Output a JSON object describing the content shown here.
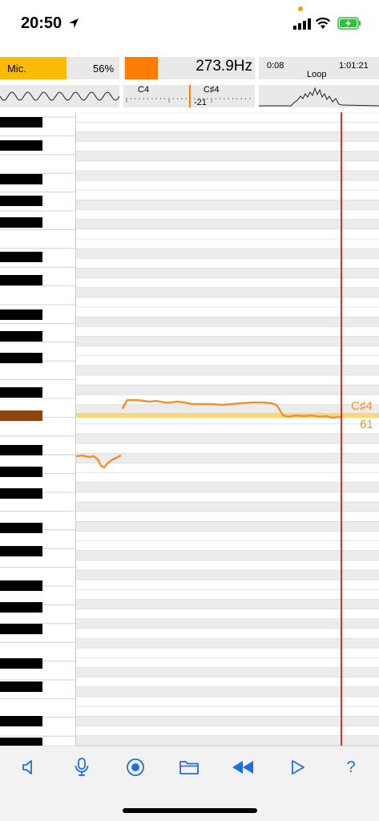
{
  "status_bar": {
    "time": "20:50"
  },
  "mic": {
    "label": "Mic.",
    "level_text": "56%",
    "level_fraction": 0.56,
    "color": "#fbbb05"
  },
  "frequency": {
    "value": "273.9Hz",
    "swatch_color": "#fd7d05"
  },
  "tuner": {
    "note_left": "C4",
    "note_right": "C♯4",
    "cents": "-21"
  },
  "timeline": {
    "start": "0:08",
    "end": "1:01:21",
    "loop_label": "Loop"
  },
  "current_note": {
    "name": "C♯4",
    "midi": "61",
    "color": "#f39131"
  },
  "icons": {
    "toolbar": [
      "speaker-icon",
      "microphone-icon",
      "record-icon",
      "folder-icon",
      "rewind-icon",
      "play-icon"
    ],
    "help_label": "?"
  },
  "colors": {
    "accent": "#1e6fe6",
    "playhead": "#f0281e",
    "highlight_row": "#fbd77a",
    "pitch_line": "#f39131",
    "active_key": "#8b4511"
  }
}
